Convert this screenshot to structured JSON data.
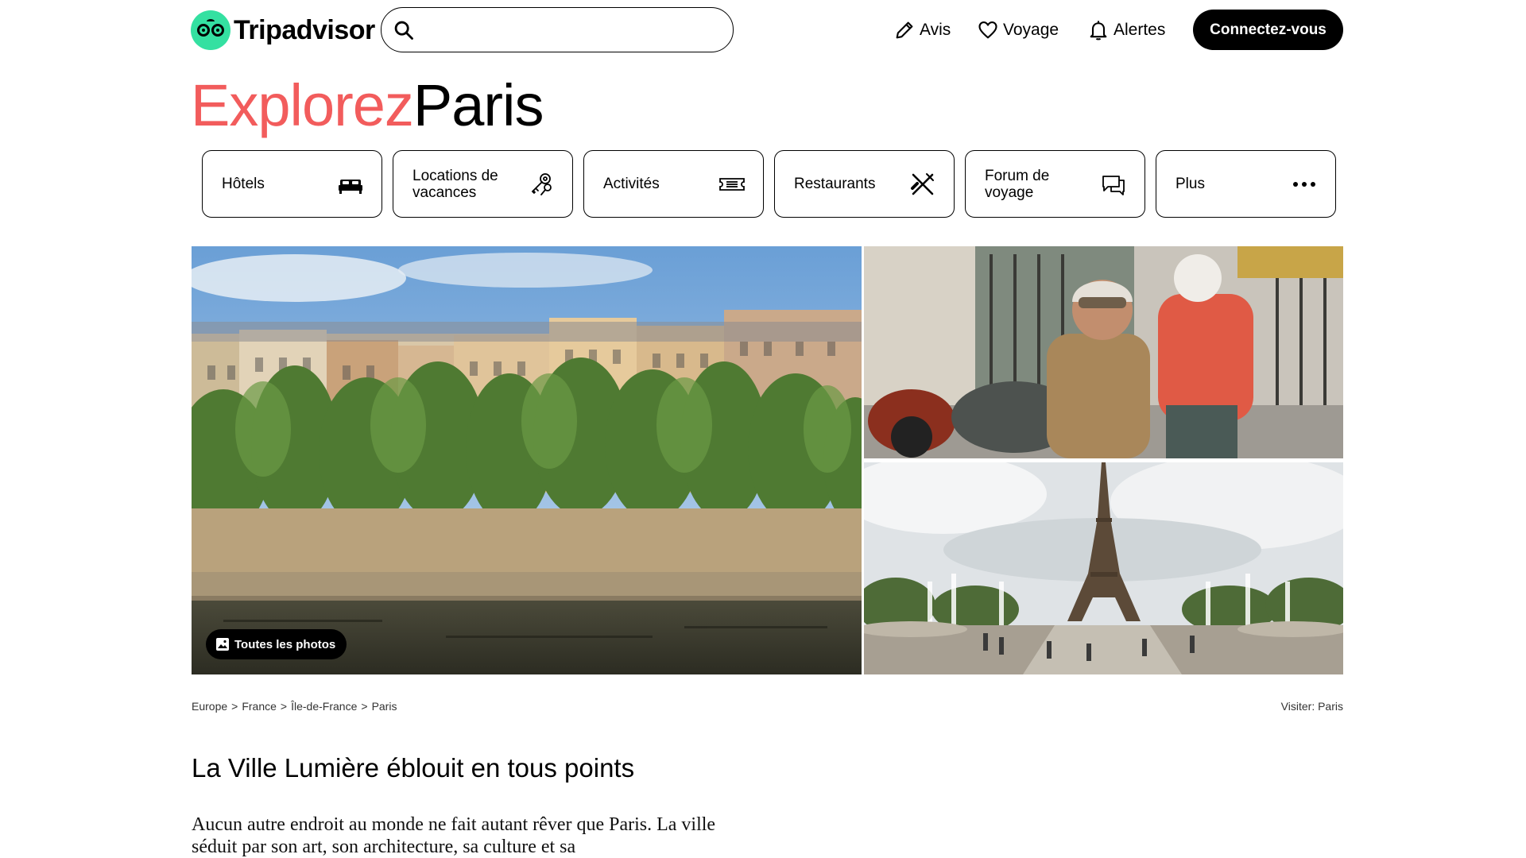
{
  "header": {
    "logo_text": "Tripadvisor",
    "search": {
      "placeholder": "",
      "value": ""
    },
    "nav": [
      {
        "label": "Avis",
        "icon": "pencil-icon"
      },
      {
        "label": "Voyage",
        "icon": "heart-icon"
      },
      {
        "label": "Alertes",
        "icon": "bell-icon"
      }
    ],
    "login_label": "Connectez-vous"
  },
  "title": {
    "accent": "Explorez",
    "place": "Paris"
  },
  "categories": [
    {
      "label": "Hôtels",
      "icon": "bed-icon"
    },
    {
      "label": "Locations de vacances",
      "icon": "keys-icon"
    },
    {
      "label": "Activités",
      "icon": "ticket-icon"
    },
    {
      "label": "Restaurants",
      "icon": "fork-knife-icon"
    },
    {
      "label": "Forum de voyage",
      "icon": "chat-icon"
    },
    {
      "label": "Plus",
      "icon": "more-icon"
    }
  ],
  "gallery": {
    "all_photos_label": "Toutes les photos",
    "photos": [
      "seine-riverbank-photo",
      "sidecar-riders-photo",
      "eiffel-tower-photo"
    ]
  },
  "breadcrumb": [
    "Europe",
    "France",
    "Île-de-France",
    "Paris"
  ],
  "visit_link": "Visiter: Paris",
  "article": {
    "heading": "La Ville Lumière éblouit en tous points",
    "body": "Aucun autre endroit au monde ne fait autant rêver que Paris. La ville séduit par son art, son architecture, sa culture et sa"
  },
  "colors": {
    "accent": "#f25c5c",
    "brand_green": "#34e0a1",
    "primary_button": "#000000"
  }
}
